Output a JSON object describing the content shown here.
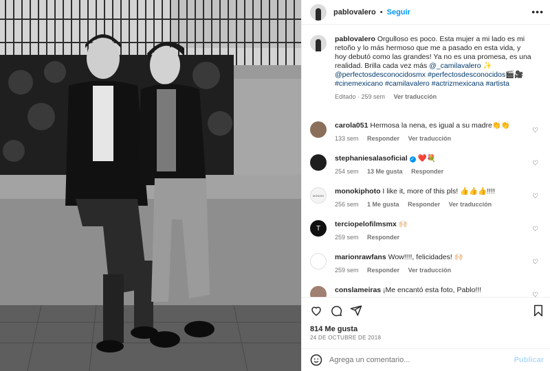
{
  "header": {
    "username": "pablovalero",
    "separator": "•",
    "follow_label": "Seguir",
    "more_label": "•••"
  },
  "caption": {
    "username": "pablovalero",
    "text": "Orgulloso es poco. Esta mujer a mi lado es mi retoño y lo más hermoso que me a pasado en esta vida, y hoy debutó como las grandes! Ya no es una promesa, es una realidad. Brilla cada vez más",
    "mention": "@_camilavalero",
    "sparkle": "✨",
    "mention2": "@perfectosdesconocidosmx",
    "tag1": "#perfectosdesconocidos",
    "tag_emoji": "🎬🎥",
    "tag2": "#cinemexicano",
    "tag3": "#camilavalero",
    "tag4": "#actrizmexicana",
    "tag5": "#artista",
    "meta_edited": "Editado · 259 sem",
    "meta_translate": "Ver traducción"
  },
  "comments": [
    {
      "username": "carola051",
      "text": "Hermosa la nena, es igual a su madre👏👏",
      "time": "133 sem",
      "reply": "Responder",
      "translate": "Ver traducción",
      "likes": "",
      "avatar_color": "#8a6f5a"
    },
    {
      "username": "stephaniesalasoficial",
      "text": "❤️💐",
      "time": "254 sem",
      "likes": "13 Me gusta",
      "reply": "Responder",
      "translate": "",
      "avatar_color": "#1e1e1e"
    },
    {
      "username": "monokiphoto",
      "text": "I like it, more of this pls! 👍👍👍!!!!",
      "time": "256 sem",
      "likes": "1 Me gusta",
      "reply": "Responder",
      "translate": "Ver traducción",
      "avatar_color": "#f4f4f4",
      "avatar_text": "MONOKI"
    },
    {
      "username": "terciopelofilmsmx",
      "text": "🙌🏻",
      "time": "259 sem",
      "likes": "",
      "reply": "Responder",
      "translate": "",
      "avatar_color": "#111111",
      "avatar_text": "T"
    },
    {
      "username": "marionrawfans",
      "text": "Wow!!!!, felicidades! 🙌🏻",
      "time": "259 sem",
      "likes": "",
      "reply": "Responder",
      "translate": "Ver traducción",
      "avatar_color": "#ffffff"
    },
    {
      "username": "conslameiras",
      "text": "¡Me encantó esta foto, Pablo!!!",
      "time": "",
      "likes": "",
      "reply": "",
      "translate": "",
      "avatar_color": "#a08070"
    }
  ],
  "footer": {
    "likes": "814 Me gusta",
    "date": "24 DE OCTUBRE DE 2018",
    "comment_placeholder": "Agrega un comentario...",
    "post_label": "Publicar"
  },
  "icons": {
    "like": "heart-icon",
    "comment": "comment-icon",
    "share": "share-icon",
    "save": "bookmark-icon",
    "emoji": "emoji-icon",
    "more": "more-options-icon"
  },
  "colors": {
    "accent": "#0095f6",
    "link": "#00376b",
    "muted": "#737373",
    "post_disabled": "#b3dbff"
  }
}
